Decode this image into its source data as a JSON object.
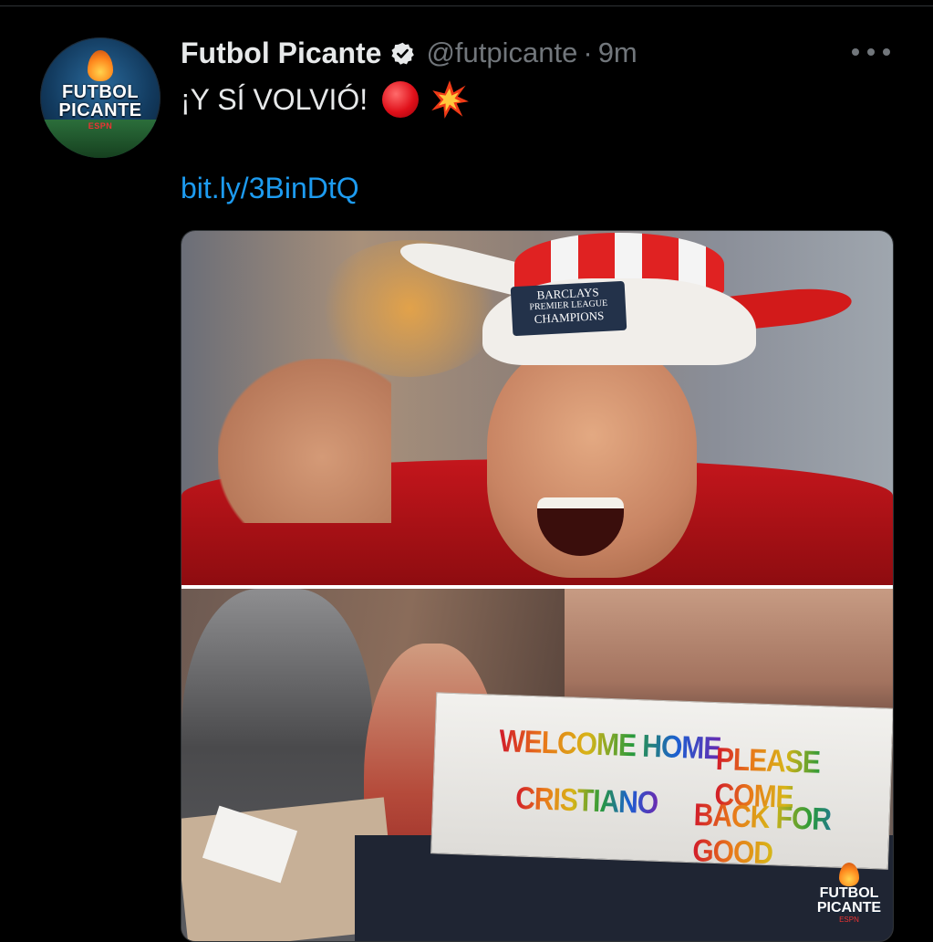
{
  "tweet": {
    "author_name": "Futbol Picante",
    "handle": "@futpicante",
    "separator": "·",
    "time": "9m",
    "text": "¡Y SÍ VOLVIÓ!",
    "link": "bit.ly/3BinDtQ",
    "icons": {
      "verified": "verified-badge-icon",
      "more": "more-options-icon",
      "emoji_1": "red-circle-emoji",
      "emoji_2": "collision-emoji"
    }
  },
  "avatar": {
    "line1": "FUTBOL",
    "line2": "PICANTE",
    "line3": "ESPN"
  },
  "media": {
    "photo1": {
      "badge_line1": "BARCLAYS",
      "badge_line2": "PREMIER LEAGUE",
      "badge_line3": "CHAMPIONS"
    },
    "photo2": {
      "sign_line1": "WELCOME HOME",
      "sign_line2": "CRISTIANO",
      "sign_line3": "PLEASE COME",
      "sign_line4": "BACK FOR GOOD",
      "watermark_line1": "FUTBOL",
      "watermark_line2": "PICANTE",
      "watermark_line3": "ESPN"
    }
  },
  "colors": {
    "background": "#000000",
    "text": "#e7e9ea",
    "secondary": "#71767b",
    "link": "#1d9bf0"
  }
}
